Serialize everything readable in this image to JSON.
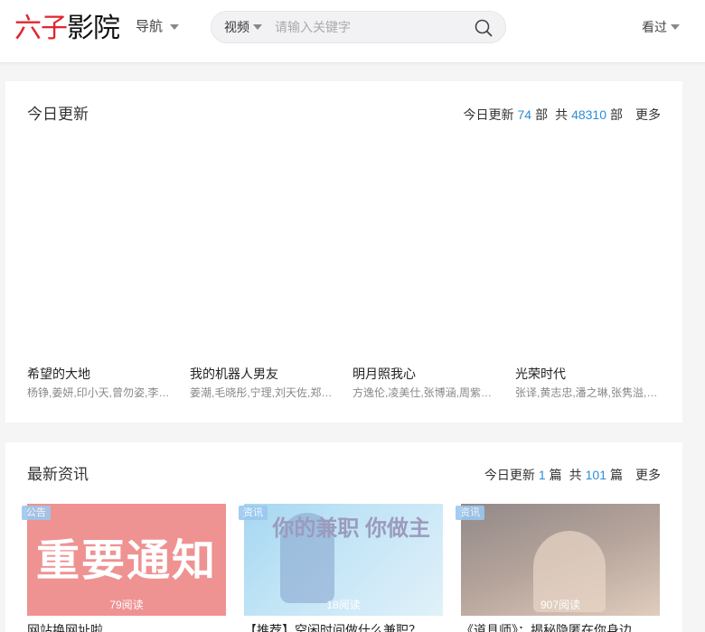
{
  "header": {
    "logo_part1": "六子",
    "logo_part2": "影院",
    "nav_label": "导航",
    "search_type": "视频",
    "search_placeholder": "请输入关键字",
    "watched_label": "看过"
  },
  "today": {
    "title": "今日更新",
    "stat_today_label": "今日更新",
    "stat_today_count": "74",
    "stat_unit": "部",
    "stat_total_label": "共",
    "stat_total_count": "48310",
    "stat_total_unit": "部",
    "more": "更多",
    "movies": [
      {
        "title": "希望的大地",
        "cast": "杨铮,姜妍,印小天,曾勿姿,李…"
      },
      {
        "title": "我的机器人男友",
        "cast": "姜潮,毛晓彤,宁理,刘天佐,郑…"
      },
      {
        "title": "明月照我心",
        "cast": "方逸伦,凌美仕,张博涵,周紫…"
      },
      {
        "title": "光荣时代",
        "cast": "张译,黄志忠,潘之琳,张隽溢,…"
      }
    ]
  },
  "news": {
    "title": "最新资讯",
    "stat_today_label": "今日更新",
    "stat_today_count": "1",
    "stat_unit": "篇",
    "stat_total_label": "共",
    "stat_total_count": "101",
    "stat_total_unit": "篇",
    "more": "更多",
    "items": [
      {
        "tag": "公告",
        "reads": "79阅读",
        "thumb_text": "重要通知",
        "title": "网站换网址啦"
      },
      {
        "tag": "资讯",
        "reads": "18阅读",
        "thumb_text": "你的兼职 你做主",
        "title": "【推荐】空闲时间做什么兼职？"
      },
      {
        "tag": "资讯",
        "reads": "907阅读",
        "thumb_text": "",
        "title": "《道具师》：揭秘隐匿在你身边"
      }
    ]
  },
  "colors": {
    "logo_red": "#e0262d",
    "accent_blue": "#2a8ed8"
  }
}
